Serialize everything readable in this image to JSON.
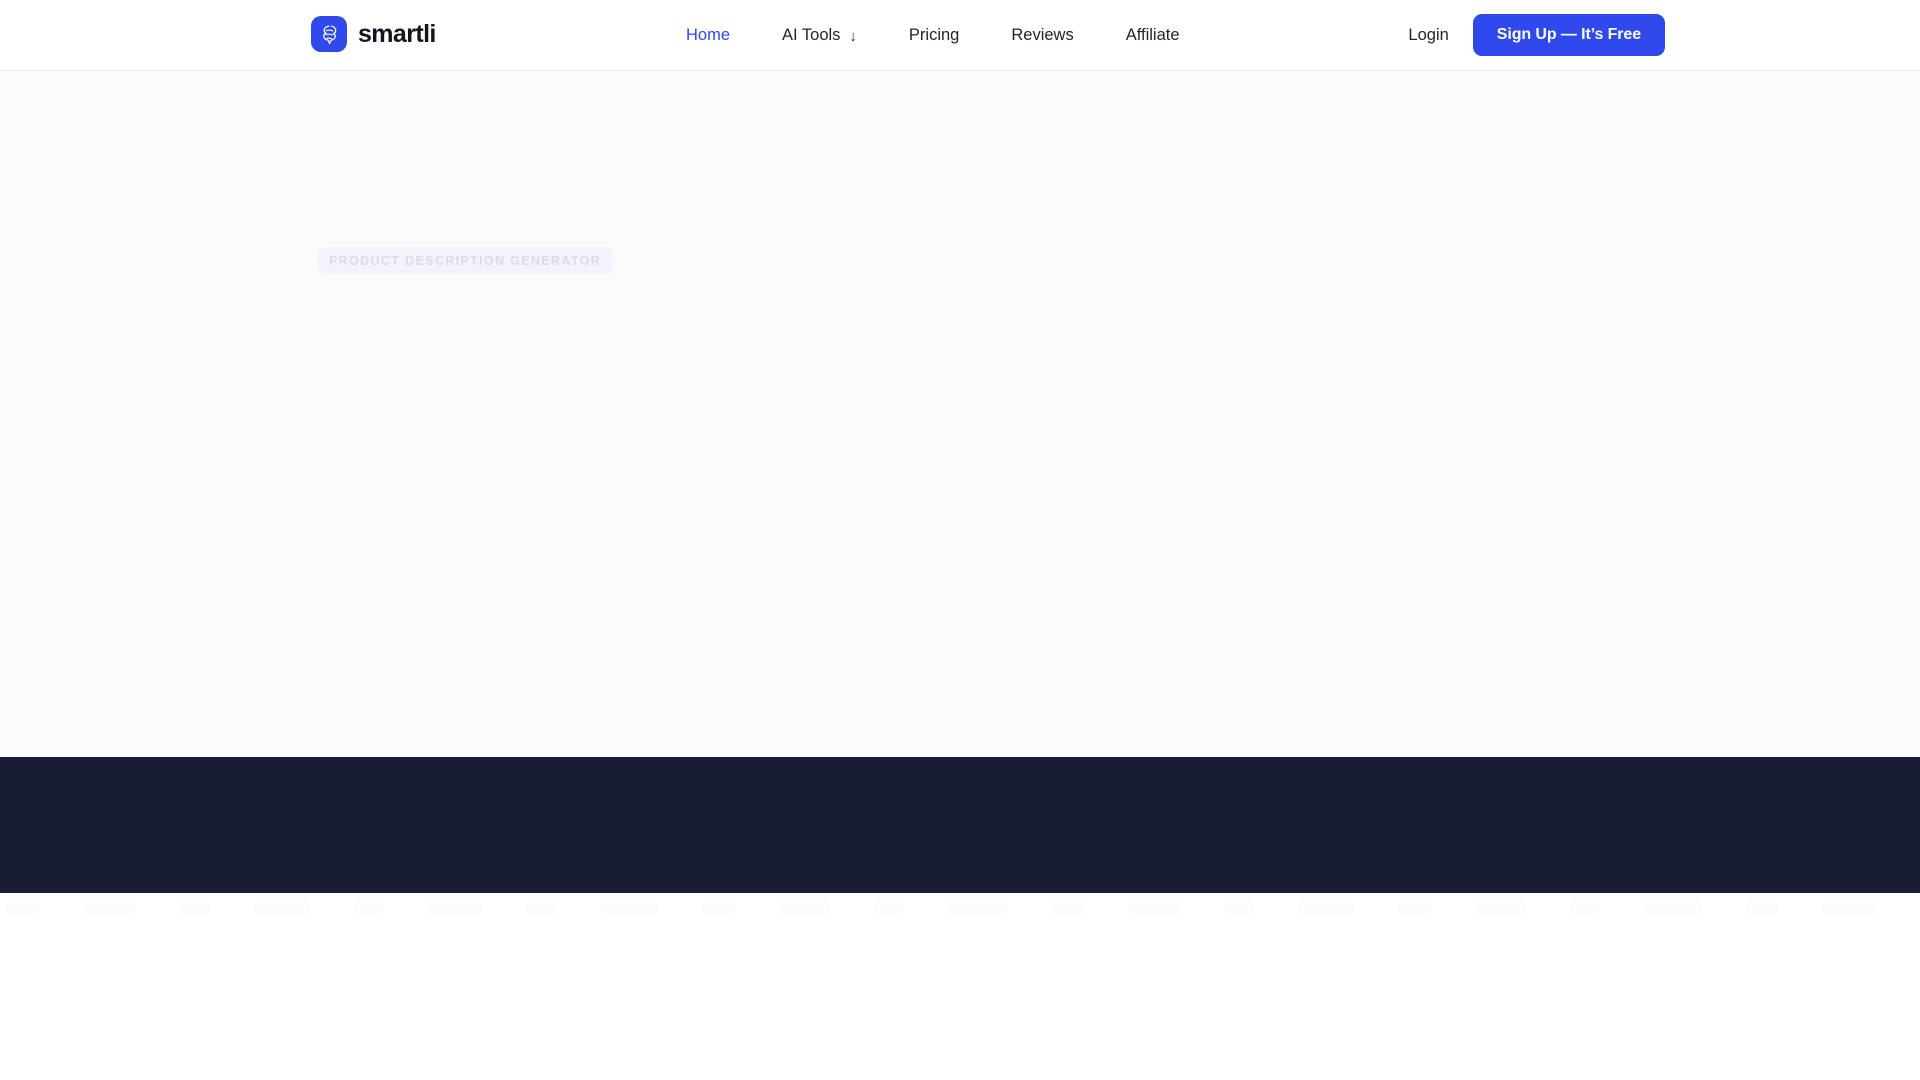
{
  "header": {
    "brand": {
      "icon": "smartli-logo-icon",
      "name": "smartli",
      "mark_color": "#2f49ec"
    },
    "nav": [
      {
        "label": "Home",
        "active": true,
        "caret": ""
      },
      {
        "label": "AI Tools",
        "active": false,
        "caret": "↓"
      },
      {
        "label": "Pricing",
        "active": false,
        "caret": ""
      },
      {
        "label": "Reviews",
        "active": false,
        "caret": ""
      },
      {
        "label": "Affiliate",
        "active": false,
        "caret": ""
      }
    ],
    "auth": {
      "login_label": "Login",
      "signup_label": "Sign Up — It’s Free",
      "signup_color": "#2f49ec"
    },
    "border_color": "#ececf1",
    "background": "#ffffff"
  },
  "hero": {
    "badge_label": "PRODUCT DESCRIPTION GENERATOR",
    "badge_text_color": "#dadaf0",
    "badge_background": "#f3f3fb",
    "background": "#fbfbfd"
  },
  "dark_band": {
    "background": "#181d35"
  },
  "logo_strip": {
    "background": "#ffffff",
    "items": [
      {
        "label": ""
      },
      {
        "label": ""
      },
      {
        "label": ""
      },
      {
        "label": ""
      },
      {
        "label": ""
      },
      {
        "label": ""
      },
      {
        "label": ""
      },
      {
        "label": ""
      },
      {
        "label": ""
      },
      {
        "label": ""
      },
      {
        "label": ""
      },
      {
        "label": ""
      },
      {
        "label": ""
      },
      {
        "label": ""
      },
      {
        "label": ""
      },
      {
        "label": ""
      },
      {
        "label": ""
      },
      {
        "label": ""
      },
      {
        "label": ""
      },
      {
        "label": ""
      },
      {
        "label": ""
      },
      {
        "label": ""
      },
      {
        "label": ""
      },
      {
        "label": ""
      },
      {
        "label": ""
      },
      {
        "label": ""
      },
      {
        "label": ""
      },
      {
        "label": ""
      }
    ]
  }
}
